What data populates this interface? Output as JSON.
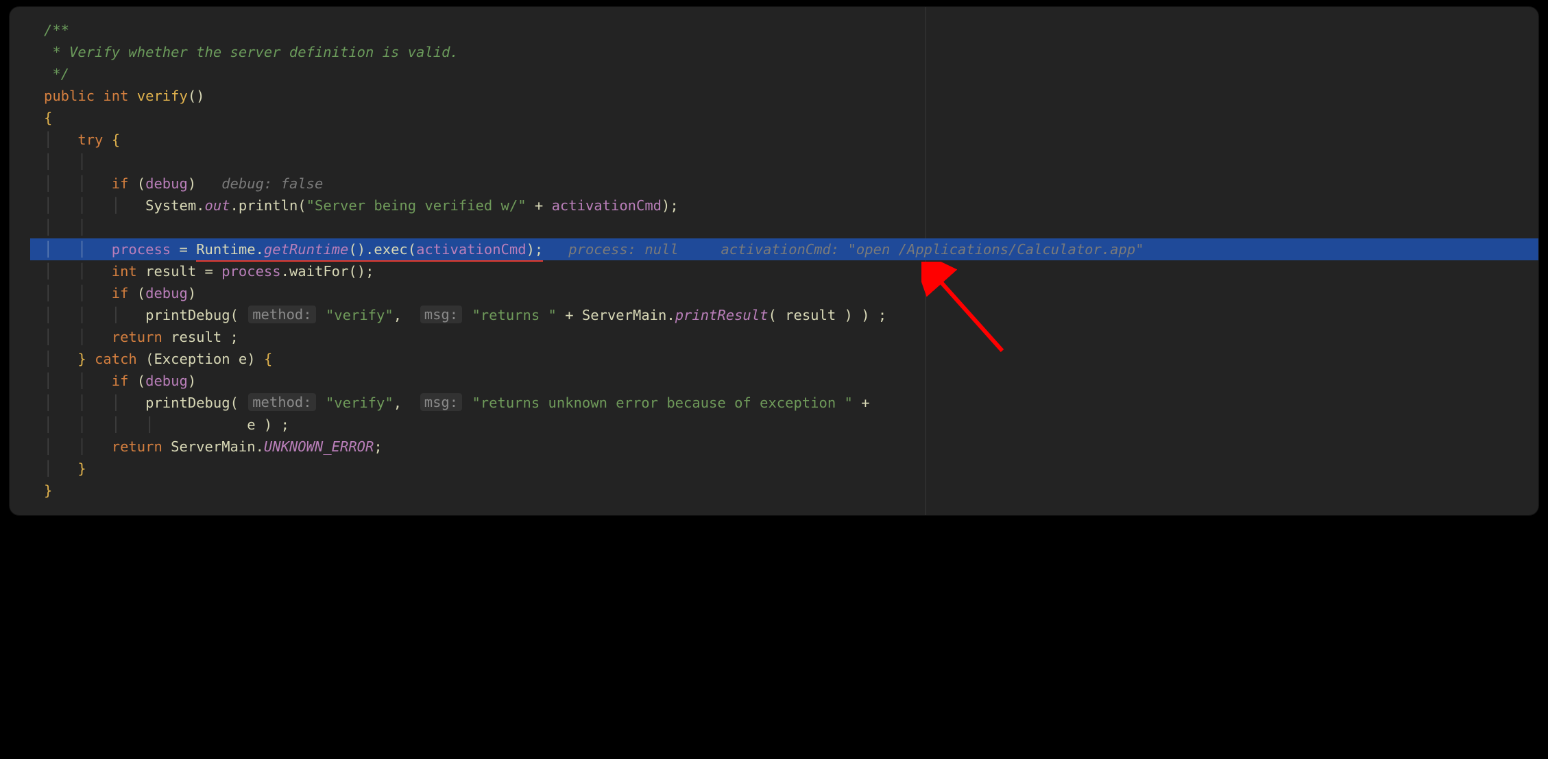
{
  "comment": {
    "l1": "/**",
    "l2": " * Verify whether the server definition is valid.",
    "l3": " */"
  },
  "sig": {
    "kw_public": "public",
    "kw_int": "int",
    "name": "verify",
    "parens": "()"
  },
  "braces": {
    "open": "{",
    "close": "}"
  },
  "try_kw": "try",
  "catch_kw": "catch",
  "exc_type": "Exception",
  "exc_var": "e",
  "if_kw": "if",
  "return_kw": "return",
  "int_kw": "int",
  "ids": {
    "debug": "debug",
    "System": "System",
    "out": "out",
    "println": "println",
    "process": "process",
    "Runtime": "Runtime",
    "getRuntime": "getRuntime",
    "exec": "exec",
    "activationCmd": "activationCmd",
    "result": "result",
    "waitFor": "waitFor",
    "printDebug": "printDebug",
    "ServerMain": "ServerMain",
    "printResult": "printResult",
    "UNKNOWN_ERROR": "UNKNOWN_ERROR"
  },
  "strings": {
    "being_verified": "\"Server being verified w/\"",
    "verify_arg": "\"verify\"",
    "returns": "\"returns \"",
    "returns_err": "\"returns unknown error because of exception \""
  },
  "hints": {
    "debug_false": "debug: false",
    "process_null": "process: null",
    "activation_val": "activationCmd: \"open /Applications/Calculator.app\"",
    "method_label": "method:",
    "msg_label": "msg:"
  },
  "punc": {
    "semi": ";",
    "plus": " + ",
    "dot": ".",
    "comma": ",",
    "lparen": "(",
    "rparen": ")",
    "eq": " = ",
    "space_semi": " ;"
  },
  "colors": {
    "highlight": "#1f4a99",
    "underline": "#e33b2e",
    "arrow": "#ff0000"
  }
}
